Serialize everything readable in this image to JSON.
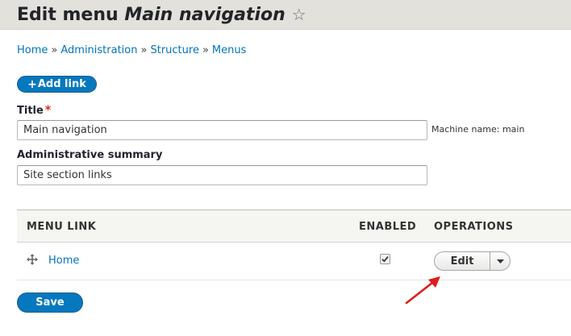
{
  "header": {
    "title_prefix": "Edit menu",
    "title_name": "Main navigation",
    "star": "☆"
  },
  "breadcrumb": {
    "items": [
      "Home",
      "Administration",
      "Structure",
      "Menus"
    ],
    "separator": "»"
  },
  "actions": {
    "add_link_plus": "+",
    "add_link_label": "Add link"
  },
  "form": {
    "title_label": "Title",
    "required_mark": "*",
    "title_value": "Main navigation",
    "machine_name": "Machine name: main",
    "summary_label": "Administrative summary",
    "summary_value": "Site section links"
  },
  "table": {
    "headers": [
      "MENU LINK",
      "ENABLED",
      "OPERATIONS"
    ],
    "rows": [
      {
        "label": "Home",
        "enabled": true,
        "op_label": "Edit"
      }
    ]
  },
  "save_label": "Save",
  "colors": {
    "accent": "#0678be",
    "link": "#0074bd",
    "header_bg": "#e2e1dc",
    "annotation": "#e01b1b",
    "required": "#e32700"
  },
  "icons": {
    "favorite": "star-icon",
    "drag": "move-handle-icon",
    "dropdown": "caret-down-icon",
    "annotation": "red-arrow-icon"
  }
}
